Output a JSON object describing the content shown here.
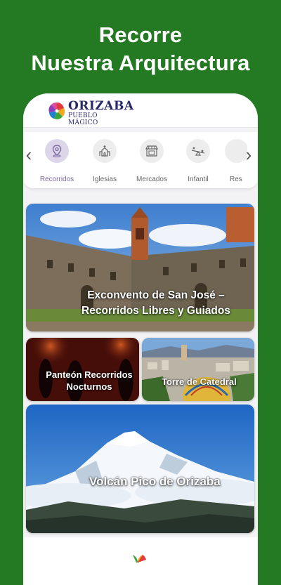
{
  "headline": {
    "line1": "Recorre",
    "line2": "Nuestra Arquitectura"
  },
  "app": {
    "logo_title": "ORIZABA",
    "logo_subtitle": "PUEBLO MÁGICO"
  },
  "categories": [
    {
      "label": "Recorridos",
      "icon": "map-pin-icon",
      "active": true
    },
    {
      "label": "Iglesias",
      "icon": "church-icon",
      "active": false
    },
    {
      "label": "Mercados",
      "icon": "market-icon",
      "active": false
    },
    {
      "label": "Infantil",
      "icon": "seesaw-icon",
      "active": false
    },
    {
      "label": "Res",
      "icon": "restaurant-icon",
      "active": false
    }
  ],
  "cards": [
    {
      "title_line1": "Exconvento de San José –",
      "title_line2": "Recorridos Libres y Guiados"
    },
    {
      "title_line1": "Panteón Recorridos",
      "title_line2": "Nocturnos"
    },
    {
      "title_line1": "Torre de Catedral"
    },
    {
      "title_line1": "Volcán Pico de Orizaba"
    }
  ],
  "colors": {
    "background": "#237a23",
    "active_category": "#ddd6ea",
    "active_label": "#7a6a9e"
  }
}
